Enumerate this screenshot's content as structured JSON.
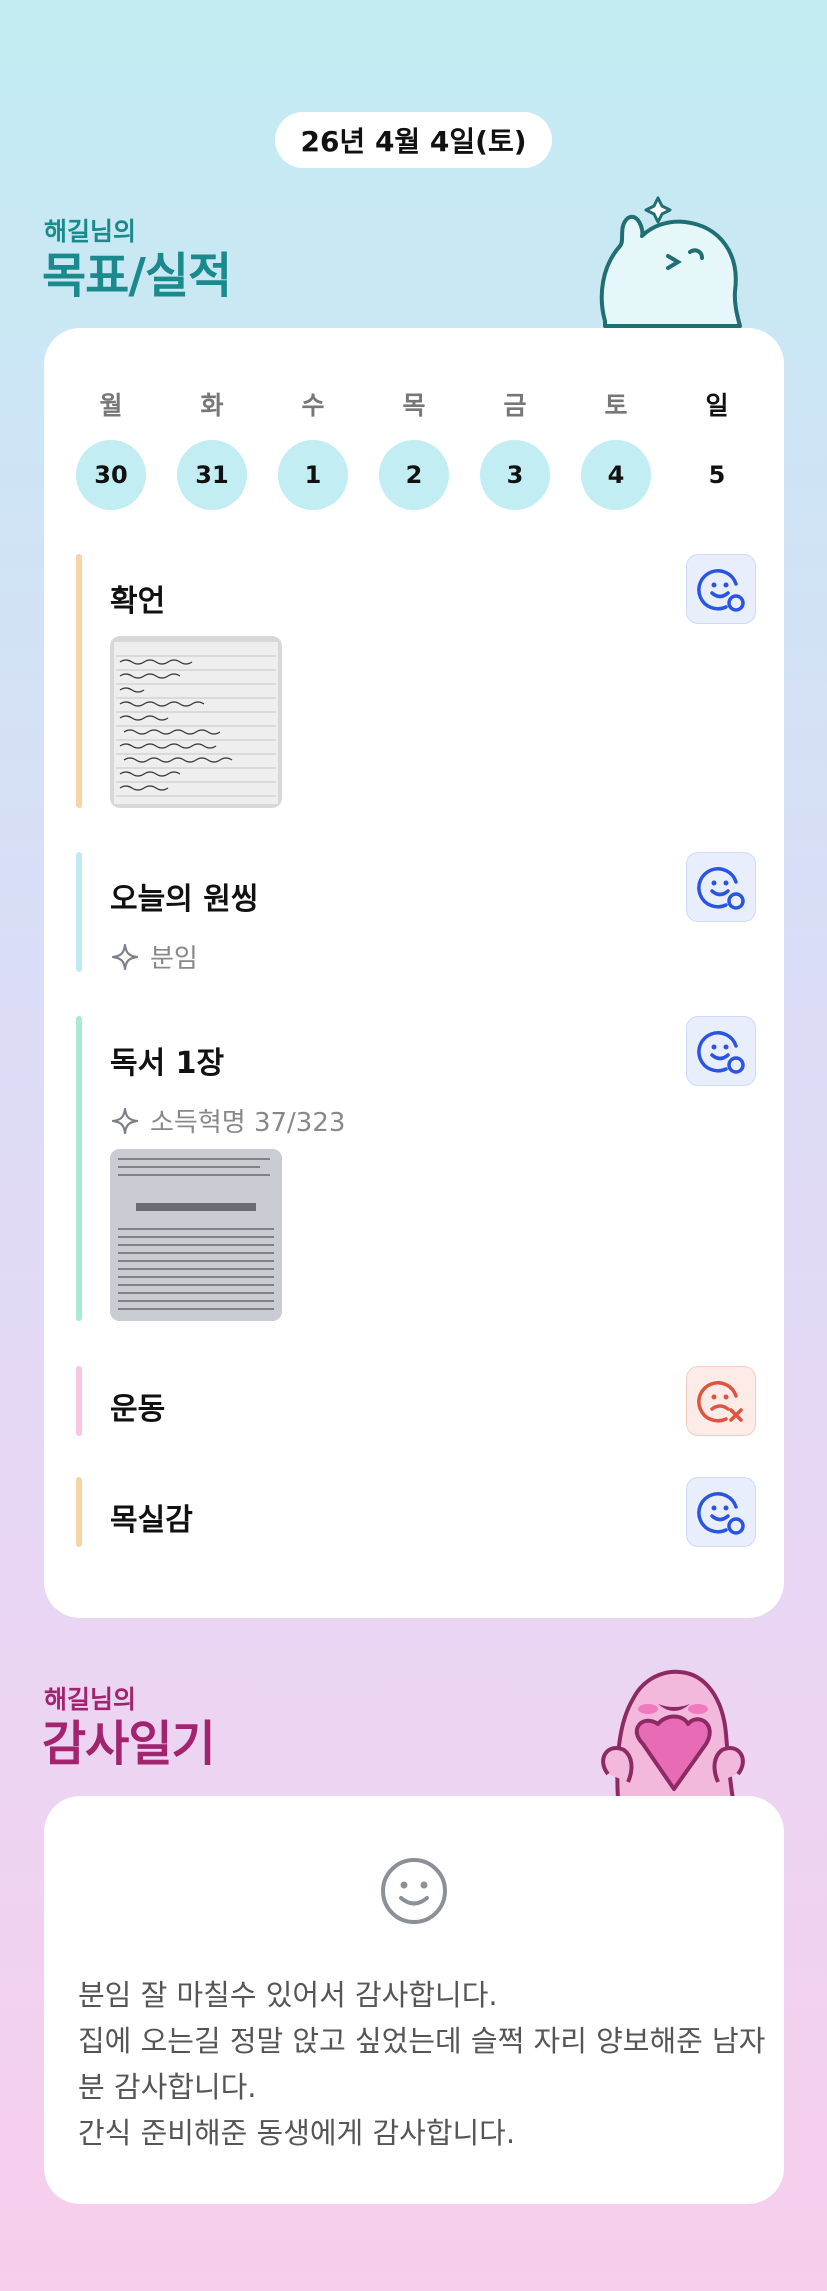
{
  "header": {
    "date": "26년 4월 4일(토)"
  },
  "goals_section": {
    "owner": "해길님의",
    "title": "목표/실적"
  },
  "week": {
    "days": [
      {
        "name": "월",
        "date": "30",
        "filled": true
      },
      {
        "name": "화",
        "date": "31",
        "filled": true
      },
      {
        "name": "수",
        "date": "1",
        "filled": true
      },
      {
        "name": "목",
        "date": "2",
        "filled": true
      },
      {
        "name": "금",
        "date": "3",
        "filled": true
      },
      {
        "name": "토",
        "date": "4",
        "filled": true
      },
      {
        "name": "일",
        "date": "5",
        "filled": false
      }
    ]
  },
  "goals": [
    {
      "title": "확언",
      "note": "",
      "status": "done",
      "bar_color": "#f9d3a6",
      "photo": "handwritten-note"
    },
    {
      "title": "오늘의 원씽",
      "note": "분임",
      "status": "done",
      "bar_color": "#bfeaf0"
    },
    {
      "title": "독서 1장",
      "note": "소득혁명 37/323",
      "status": "done",
      "bar_color": "#a9ead2",
      "photo": "book-page"
    },
    {
      "title": "운동",
      "note": "",
      "status": "missed",
      "bar_color": "#f8c6e3"
    },
    {
      "title": "목실감",
      "note": "",
      "status": "done",
      "bar_color": "#f9d3a6"
    }
  ],
  "gratitude_section": {
    "owner": "해길님의",
    "title": "감사일기"
  },
  "gratitude": {
    "icon": "smile-face-icon",
    "text": "분임 잘 마칠수 있어서 감사합니다.\n집에 오는길 정말 앉고 싶었는데 슬쩍 자리 양보해준 남자분 감사합니다.\n간식 준비해준 동생에게 감사합니다."
  },
  "colors": {
    "accent_teal": "#1b8a8c",
    "accent_magenta": "#a2246f",
    "status_done": "#2a55e0",
    "status_missed": "#e0533c"
  }
}
